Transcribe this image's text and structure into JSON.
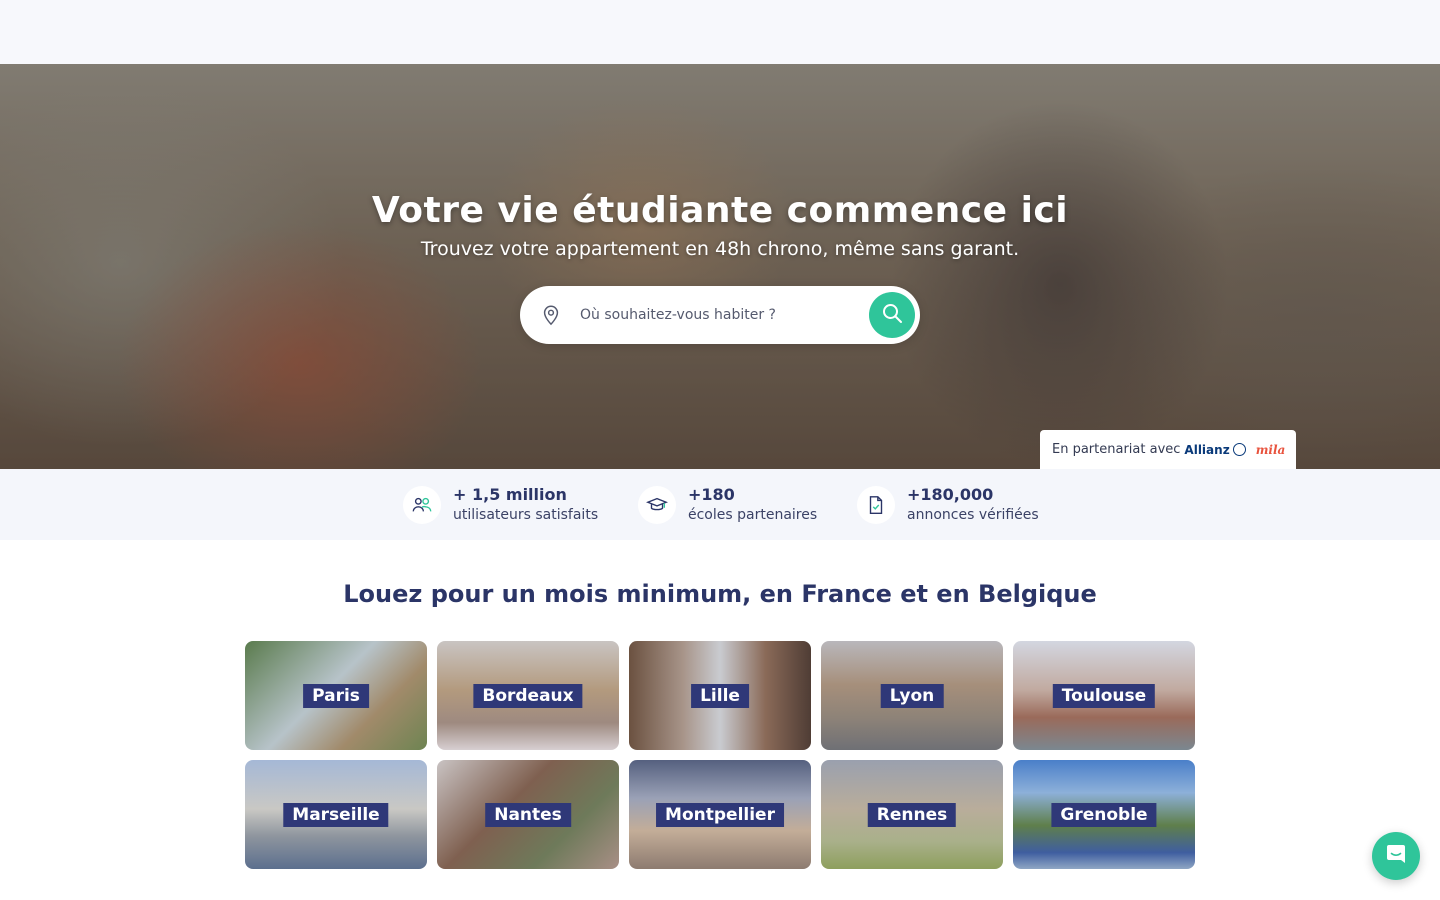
{
  "hero": {
    "title": "Votre vie étudiante commence ici",
    "subtitle": "Trouvez votre appartement en 48h chrono, même sans garant.",
    "search_placeholder": "Où souhaitez-vous habiter ?",
    "partner_text": "En partenariat avec",
    "partner_brands": [
      "Allianz",
      "mila"
    ]
  },
  "stats": [
    {
      "value": "+ 1,5 million",
      "label": "utilisateurs satisfaits",
      "icon": "users-icon"
    },
    {
      "value": "+180",
      "label": "écoles partenaires",
      "icon": "graduation-cap-icon"
    },
    {
      "value": "+180,000",
      "label": "annonces vérifiées",
      "icon": "verified-document-icon"
    }
  ],
  "section_title": "Louez pour un mois minimum, en France et en Belgique",
  "cities": [
    "Paris",
    "Bordeaux",
    "Lille",
    "Lyon",
    "Toulouse",
    "Marseille",
    "Nantes",
    "Montpellier",
    "Rennes",
    "Grenoble"
  ],
  "colors": {
    "accent": "#2fc59a",
    "navy": "#2b3567",
    "label_bg": "#2f3878"
  }
}
